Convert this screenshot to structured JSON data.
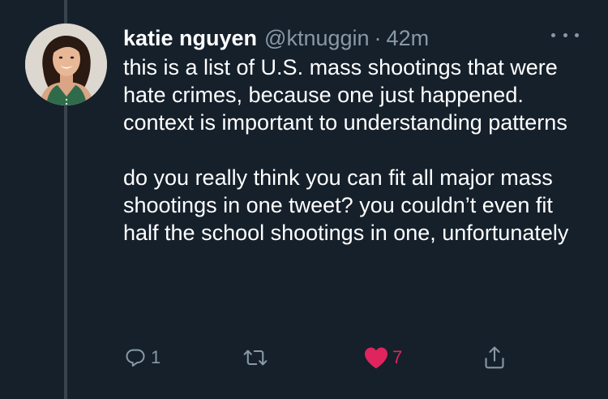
{
  "tweet": {
    "author": {
      "name": "katie nguyen",
      "handle": "@ktnuggin"
    },
    "separator": "·",
    "time": "42m",
    "paragraphs": [
      "this is a list of U.S. mass shootings that were hate crimes, because one just happened. context is important to understanding patterns",
      "do you really think you can fit all major mass shootings in one tweet? you couldn’t even fit half the school shootings in one, unfortunately"
    ],
    "actions": {
      "reply_count": "1",
      "retweet_count": "",
      "like_count": "7"
    },
    "icons": {
      "reply": "reply-icon",
      "retweet": "retweet-icon",
      "like": "heart-icon",
      "share": "share-icon",
      "more": "more-options-icon"
    }
  },
  "colors": {
    "background": "#15202b",
    "text_primary": "#ffffff",
    "text_secondary": "#8899a6",
    "like_active": "#e0245e",
    "thread_line": "#38444d"
  }
}
